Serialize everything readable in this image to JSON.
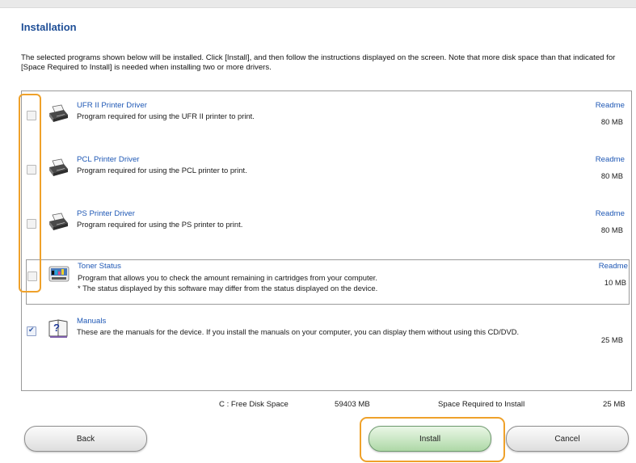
{
  "title": "Installation",
  "intro": "The selected programs shown below will be installed. Click [Install], and then follow the instructions displayed on the screen. Note that more disk space than that indicated for [Space Required to Install] is needed when installing two or more drivers.",
  "items": [
    {
      "name": "UFR II Printer Driver",
      "desc": "Program required for using the UFR II printer to print.",
      "readme": "Readme",
      "size": "80 MB",
      "checked": false,
      "icon": "printer-icon"
    },
    {
      "name": "PCL Printer Driver",
      "desc": "Program required for using the PCL printer to print.",
      "readme": "Readme",
      "size": "80 MB",
      "checked": false,
      "icon": "printer-icon"
    },
    {
      "name": "PS Printer Driver",
      "desc": "Program required for using the PS printer to print.",
      "readme": "Readme",
      "size": "80 MB",
      "checked": false,
      "icon": "printer-icon"
    },
    {
      "name": "Toner Status",
      "desc": "Program that allows you to check the amount remaining in cartridges from your computer.",
      "note": "* The status displayed by this software may differ from the status displayed on the device.",
      "readme": "Readme",
      "size": "10 MB",
      "checked": false,
      "icon": "toner-status-icon"
    },
    {
      "name": "Manuals",
      "desc": "These are the manuals for the device. If you install the manuals on your computer, you can display them without using this CD/DVD.",
      "size": "25 MB",
      "checked": true,
      "icon": "manual-help-icon"
    }
  ],
  "footer": {
    "free_label": "C : Free Disk Space",
    "free_value": "59403 MB",
    "required_label": "Space Required to Install",
    "required_value": "25 MB"
  },
  "buttons": {
    "back": "Back",
    "install": "Install",
    "cancel": "Cancel"
  },
  "colors": {
    "title": "#1f4f97",
    "link": "#1f58b5",
    "highlight": "#efa12a",
    "install_button": "#aed8a7"
  }
}
